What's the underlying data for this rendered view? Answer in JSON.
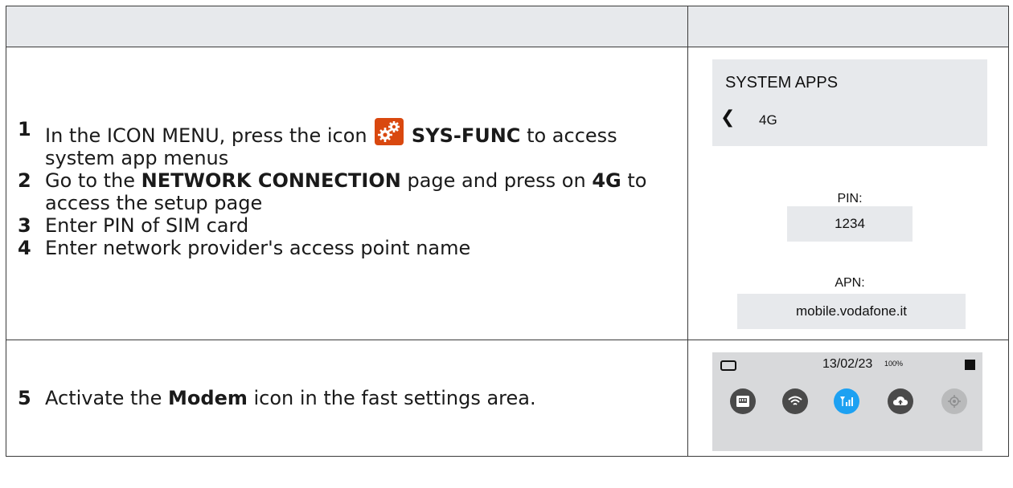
{
  "steps_cell": {
    "steps": [
      {
        "num": "1",
        "pre": "In the ICON MENU, press the icon",
        "bold": "SYS-FUNC",
        "post": "to access system app menus"
      },
      {
        "num": "2",
        "pre": "Go to the",
        "bold": "NETWORK CONNECTION",
        "mid": "page and press on",
        "bold2": "4G",
        "post": "to access the setup page"
      },
      {
        "num": "3",
        "text": "Enter PIN of SIM card"
      },
      {
        "num": "4",
        "text": "Enter network provider's access point name"
      }
    ],
    "icon": "sys-func-gears-icon",
    "icon_color": "#d9480f"
  },
  "step5": {
    "num": "5",
    "pre": "Activate the",
    "bold": "Modem",
    "post": "icon in the fast settings area."
  },
  "device_setup": {
    "title": "SYSTEM APPS",
    "back_icon": "chevron-left-icon",
    "subtitle": "4G",
    "pin_label": "PIN:",
    "pin_value": "1234",
    "apn_label": "APN:",
    "apn_value": "mobile.vodafone.it"
  },
  "device_quick": {
    "date": "13/02/23",
    "battery_pct": "100%",
    "icons": [
      "ethernet-icon",
      "wifi-icon",
      "modem-signal-icon",
      "cloud-upload-icon",
      "gps-icon"
    ],
    "active_icon": "modem-signal-icon",
    "active_color": "#1da1f2"
  }
}
